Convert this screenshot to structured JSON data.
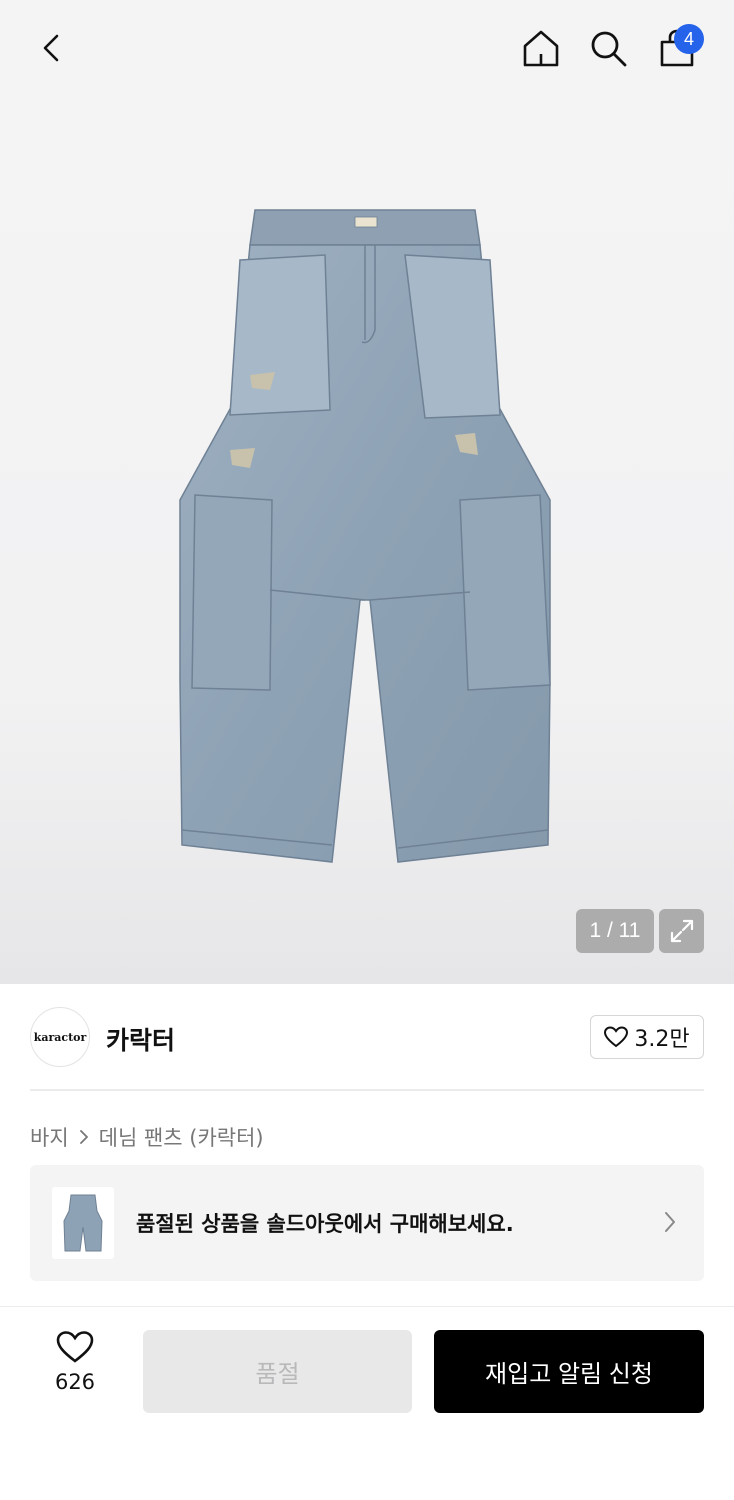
{
  "header": {
    "cart_count": "4"
  },
  "gallery": {
    "counter": "1 / 11"
  },
  "brand": {
    "logo_text": "karactor",
    "name": "카락터",
    "like_count": "3.2만"
  },
  "breadcrumb": {
    "category": "바지",
    "subcategory": "데님 팬츠 (카락터)"
  },
  "soldout_banner": {
    "text": "품절된 상품을 솔드아웃에서 구매해보세요."
  },
  "bottom_bar": {
    "wish_count": "626",
    "soldout_label": "품절",
    "restock_label": "재입고 알림 신청"
  }
}
